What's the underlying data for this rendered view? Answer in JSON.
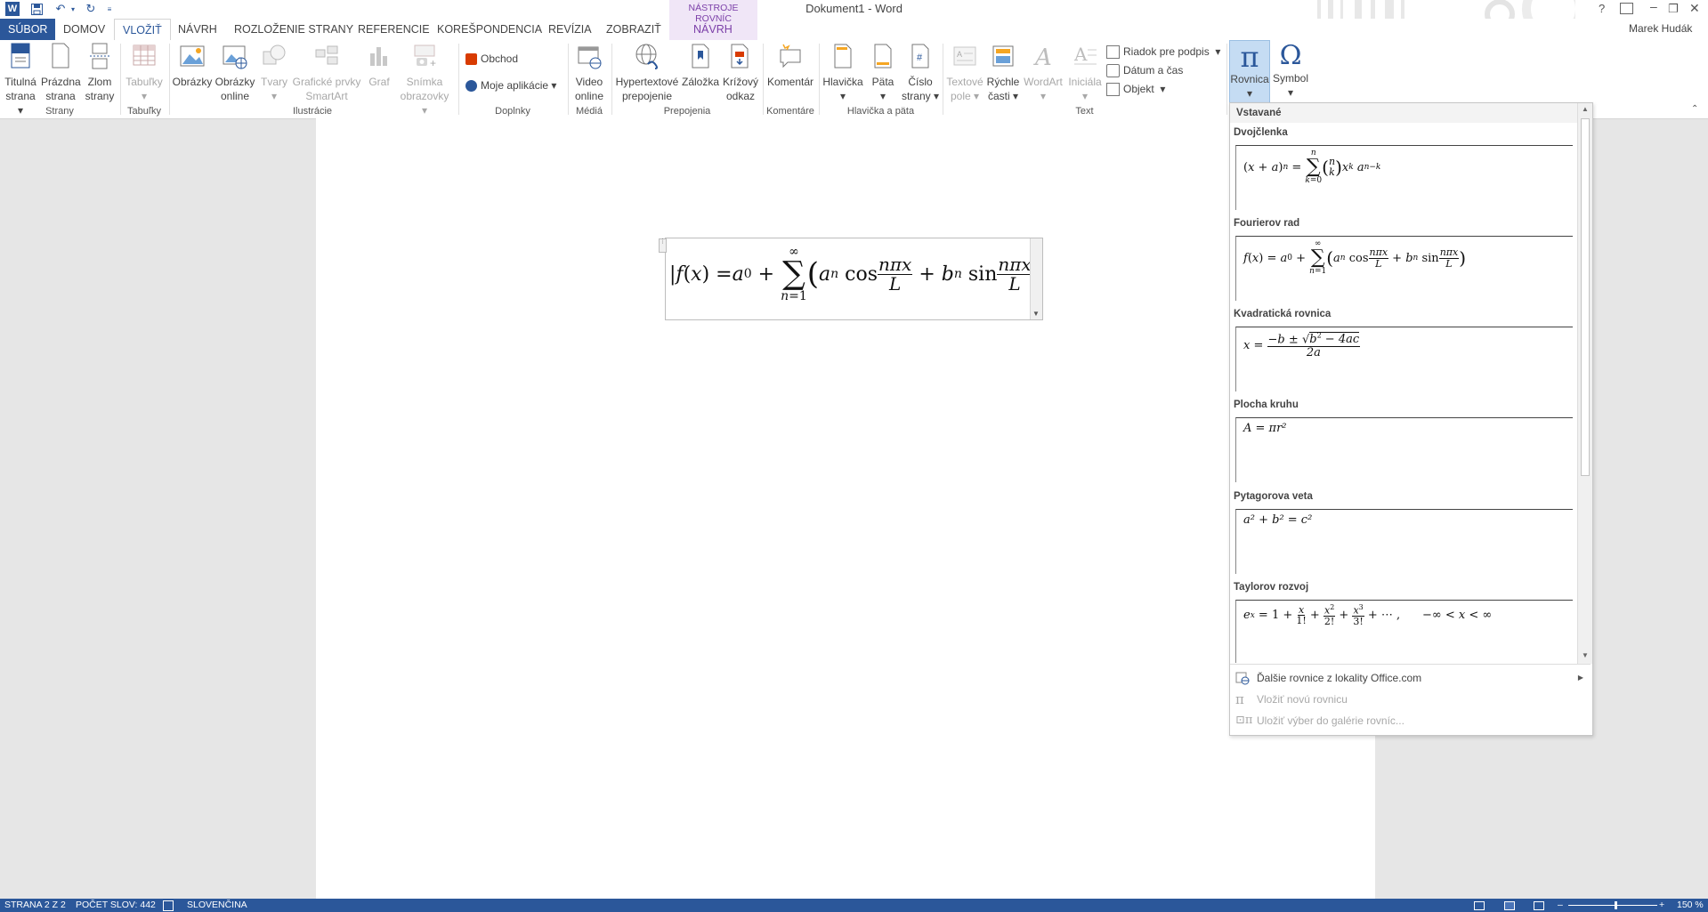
{
  "window": {
    "title": "Dokument1 - Word",
    "user": "Marek Hudák",
    "help": "?",
    "controls": [
      "?",
      "▭",
      "–",
      "❐",
      "✕"
    ]
  },
  "tabs": [
    {
      "label": "SÚBOR",
      "kind": "file"
    },
    {
      "label": "DOMOV"
    },
    {
      "label": "VLOŽIŤ",
      "active": true
    },
    {
      "label": "NÁVRH"
    },
    {
      "label": "ROZLOŽENIE STRANY"
    },
    {
      "label": "REFERENCIE"
    },
    {
      "label": "KOREŠPONDENCIA"
    },
    {
      "label": "REVÍZIA"
    },
    {
      "label": "ZOBRAZIŤ"
    }
  ],
  "context_tab": {
    "group": "NÁSTROJE ROVNÍC",
    "label": "NÁVRH"
  },
  "ribbon": {
    "groups": {
      "strany": "Strany",
      "tabulky": "Tabuľky",
      "ilustracie": "Ilustrácie",
      "doplnky": "Doplnky",
      "media": "Médiá",
      "prepojenia": "Prepojenia",
      "komentare": "Komentáre",
      "hlavicka": "Hlavička a päta",
      "text": "Text"
    },
    "buttons": {
      "titulna_1": "Titulná",
      "titulna_2": "strana",
      "prazdna_1": "Prázdna",
      "prazdna_2": "strana",
      "zlom_1": "Zlom",
      "zlom_2": "strany",
      "tabulky": "Tabuľky",
      "obrazky": "Obrázky",
      "obrazky_online_1": "Obrázky",
      "obrazky_online_2": "online",
      "tvary": "Tvary",
      "smartart_1": "Grafické prvky",
      "smartart_2": "SmartArt",
      "graf": "Graf",
      "snimka_1": "Snímka",
      "snimka_2": "obrazovky",
      "obchod": "Obchod",
      "moje_aplikacie": "Moje aplikácie",
      "video_1": "Video",
      "video_2": "online",
      "hyper_1": "Hypertextové",
      "hyper_2": "prepojenie",
      "zalozka": "Záložka",
      "krizovy_1": "Krížový",
      "krizovy_2": "odkaz",
      "komentar": "Komentár",
      "hlavicka": "Hlavička",
      "pata": "Päta",
      "cislo_1": "Číslo",
      "cislo_2": "strany",
      "textove_1": "Textové",
      "textove_2": "pole",
      "rychle_1": "Rýchle",
      "rychle_2": "časti",
      "wordart": "WordArt",
      "inicialka": "Iniciála",
      "riadok_podpis": "Riadok pre podpis",
      "datum_cas": "Dátum a čas",
      "objekt": "Objekt",
      "rovnica": "Rovnica",
      "symbol": "Symbol"
    }
  },
  "gallery": {
    "header": "Vstavané",
    "items": [
      {
        "title": "Dvojčlenka"
      },
      {
        "title": "Fourierov rad"
      },
      {
        "title": "Kvadratická rovnica"
      },
      {
        "title": "Plocha kruhu",
        "equation": "A = πr²"
      },
      {
        "title": "Pytagorova veta",
        "equation": "a² + b² = c²"
      },
      {
        "title": "Taylorov rozvoj"
      }
    ],
    "footer": [
      {
        "label": "Ďalšie rovnice z lokality Office.com",
        "enabled": true
      },
      {
        "label": "Vložiť novú rovnicu",
        "enabled": false
      },
      {
        "label": "Uložiť výber do galérie rovníc...",
        "enabled": false
      }
    ]
  },
  "status": {
    "page": "STRANA 2 Z 2",
    "words": "POČET SLOV: 442",
    "language": "SLOVENČINA",
    "zoom": "150 %"
  },
  "colors": {
    "accent": "#2b579a",
    "context": "#7b3fa8"
  }
}
